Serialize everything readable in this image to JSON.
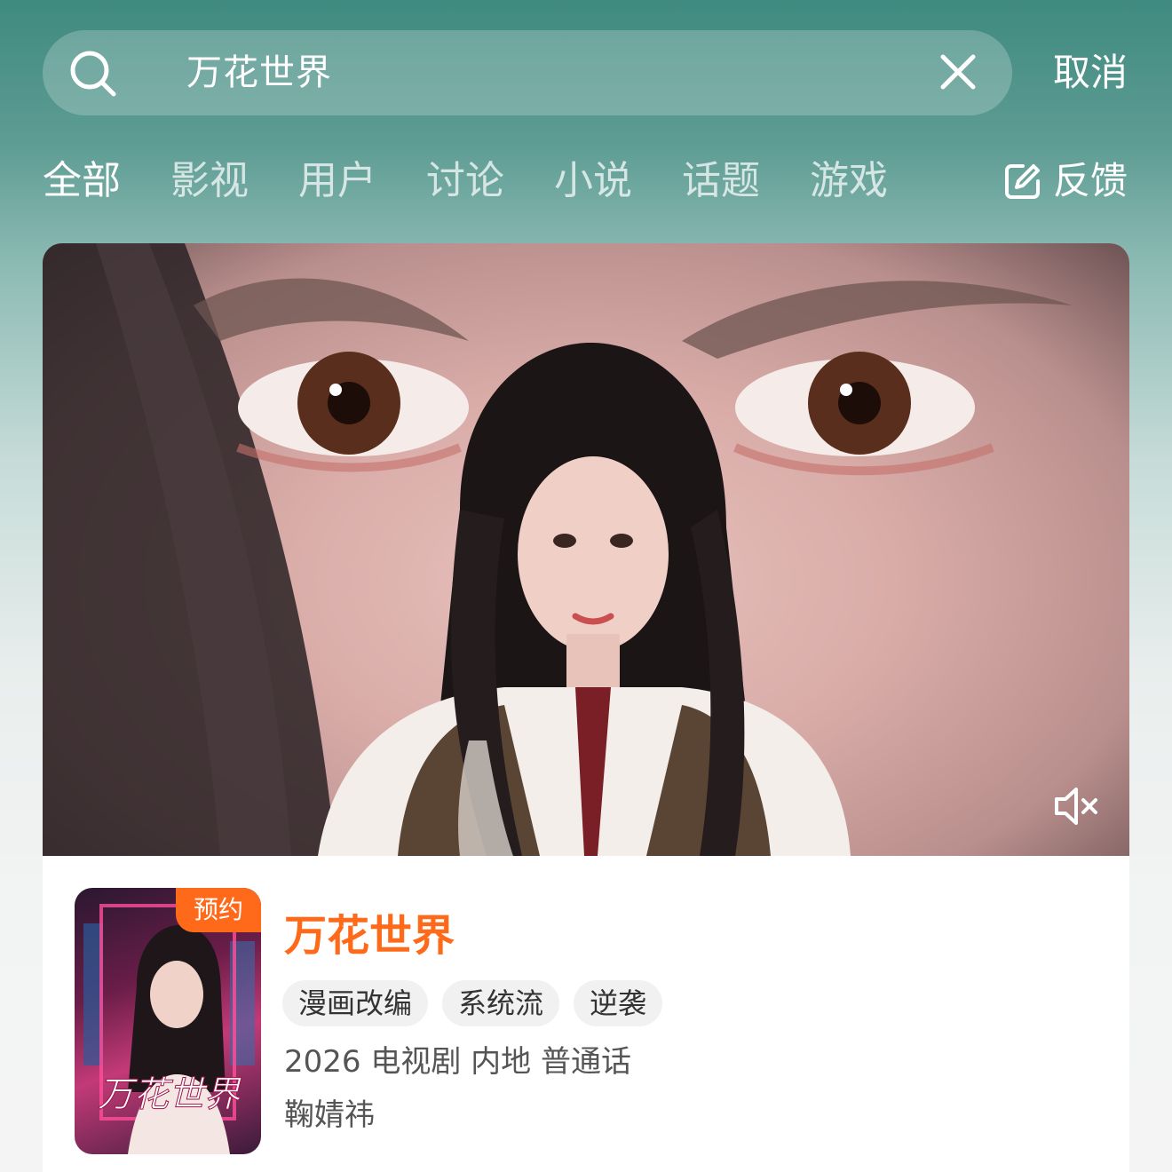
{
  "search": {
    "query": "万花世界",
    "cancel_label": "取消"
  },
  "tabs": [
    {
      "label": "全部",
      "active": true
    },
    {
      "label": "影视",
      "active": false
    },
    {
      "label": "用户",
      "active": false
    },
    {
      "label": "讨论",
      "active": false
    },
    {
      "label": "小说",
      "active": false
    },
    {
      "label": "话题",
      "active": false
    },
    {
      "label": "游戏",
      "active": false
    }
  ],
  "feedback_label": "反馈",
  "result": {
    "badge": "预约",
    "title": "万花世界",
    "tags": [
      "漫画改编",
      "系统流",
      "逆袭"
    ],
    "meta": "2026 电视剧 内地 普通话",
    "cast": "鞠婧祎",
    "poster_logo_text": "万花世界"
  },
  "colors": {
    "accent": "#ff6a1a",
    "header_bg": "#4a8f86"
  },
  "icons": {
    "search": "search-icon",
    "clear": "close-icon",
    "feedback": "edit-icon",
    "mute": "mute-icon"
  }
}
